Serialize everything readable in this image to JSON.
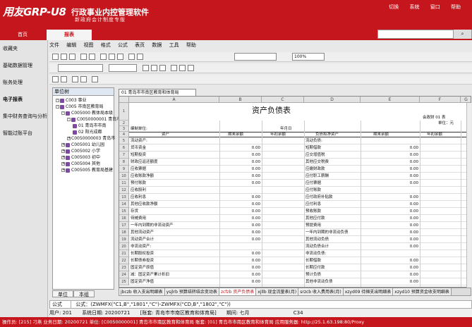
{
  "app": {
    "logo": "用友GRP-U8",
    "product_name": "行政事业内控管理软件",
    "product_sub": "新政府会计制度专版",
    "top_menu": [
      "切换",
      "系统",
      "窗口",
      "帮助"
    ]
  },
  "modules": {
    "home": "首页",
    "report": "报表"
  },
  "left_nav": [
    "收藏夹",
    "基础数据管理",
    "账务处理",
    "电子报表",
    "集中财务查询与分析",
    "智能过账平台"
  ],
  "menubar": [
    "文件",
    "编辑",
    "视图",
    "格式",
    "公式",
    "表页",
    "数据",
    "工具",
    "帮助"
  ],
  "toolbar": {
    "zoom": "100%"
  },
  "tree": {
    "header": "单位树",
    "nodes": [
      "C003 事业",
      "C005 市南区教育局",
      "C005000 教体局本级",
      "C0050000001 青岛市市",
      "01 青岛市市南",
      "02 阳光成都",
      "C0050000003 青岛市",
      "C005001 幼儿园",
      "C005002 小学",
      "C005003 初中",
      "C005004 其他",
      "C005005 教育局基建"
    ],
    "tabs": [
      "单位",
      "本组"
    ]
  },
  "doc_tab": "01 青岛市市南区教育和体育局",
  "sheet": {
    "columns": [
      "A",
      "B",
      "C",
      "D",
      "E",
      "F",
      "G"
    ],
    "title": "资产负债表",
    "form_no": "会政财 01 表",
    "unit_label": "单位：元",
    "compiler": "编制单位:",
    "period": "年月日",
    "headers": [
      "资产",
      "期末余额",
      "年初余额",
      "负债和净资产",
      "期末余额",
      "年初余额"
    ],
    "rows": [
      {
        "n": "5",
        "a": "流动资产:",
        "d": "流动负债:",
        "b": "",
        "c": "",
        "e": "",
        "f": ""
      },
      {
        "n": "6",
        "a": "货币资金",
        "b": "0.00",
        "c": "",
        "d": "短期借款",
        "e": "0.00",
        "f": ""
      },
      {
        "n": "7",
        "a": "短期投资",
        "b": "0.00",
        "c": "",
        "d": "应交增值税",
        "e": "0.00",
        "f": ""
      },
      {
        "n": "8",
        "a": "财政应返还额度",
        "b": "0.00",
        "c": "",
        "d": "其他应交税费",
        "e": "0.00",
        "f": ""
      },
      {
        "n": "9",
        "a": "应收票据",
        "b": "0.00",
        "c": "",
        "d": "应缴财政款",
        "e": "0.00",
        "f": ""
      },
      {
        "n": "10",
        "a": "应收账款净额",
        "b": "0.00",
        "c": "",
        "d": "应付职工薪酬",
        "e": "0.00",
        "f": ""
      },
      {
        "n": "11",
        "a": "预付账款",
        "b": "0.00",
        "c": "",
        "d": "应付票据",
        "e": "0.00",
        "f": ""
      },
      {
        "n": "12",
        "a": "应收股利",
        "b": "",
        "c": "",
        "d": "应付账款",
        "e": "",
        "f": ""
      },
      {
        "n": "13",
        "a": "应收利息",
        "b": "0.00",
        "c": "",
        "d": "应付政府补贴款",
        "e": "0.00",
        "f": ""
      },
      {
        "n": "14",
        "a": "其他应收款净额",
        "b": "0.00",
        "c": "",
        "d": "应付利息",
        "e": "0.00",
        "f": ""
      },
      {
        "n": "15",
        "a": "存货",
        "b": "0.00",
        "c": "",
        "d": "预收账款",
        "e": "0.00",
        "f": ""
      },
      {
        "n": "16",
        "a": "待摊费用",
        "b": "0.00",
        "c": "",
        "d": "其他应付款",
        "e": "0.00",
        "f": ""
      },
      {
        "n": "17",
        "a": "一年内到期的非流动资产",
        "b": "0.00",
        "c": "",
        "d": "预提费用",
        "e": "0.00",
        "f": ""
      },
      {
        "n": "18",
        "a": "其他流动资产",
        "b": "0.00",
        "c": "",
        "d": "一年内到期的非流动负债",
        "e": "0.00",
        "f": ""
      },
      {
        "n": "19",
        "a": "流动资产合计",
        "b": "0.00",
        "c": "",
        "d": "其他流动负债",
        "e": "0.00",
        "f": ""
      },
      {
        "n": "20",
        "a": "非流动资产:",
        "b": "",
        "c": "",
        "d": "流动负债合计",
        "e": "0.00",
        "f": ""
      },
      {
        "n": "21",
        "a": "长期股权投资",
        "b": "0.00",
        "c": "",
        "d": "非流动负债:",
        "e": "",
        "f": ""
      },
      {
        "n": "22",
        "a": "长期债券投资",
        "b": "0.00",
        "c": "",
        "d": "长期借款",
        "e": "0.00",
        "f": ""
      },
      {
        "n": "23",
        "a": "固定资产原值",
        "b": "0.00",
        "c": "",
        "d": "长期应付款",
        "e": "0.00",
        "f": ""
      },
      {
        "n": "24",
        "a": "减：固定资产累计折旧",
        "b": "0.00",
        "c": "",
        "d": "预计负债",
        "e": "0.00",
        "f": ""
      },
      {
        "n": "25",
        "a": "固定资产净值",
        "b": "0.00",
        "c": "",
        "d": "其他非流动负债",
        "e": "0.00",
        "f": ""
      }
    ]
  },
  "sheet_tabs": [
    "jbczb 收入支出明细表",
    "ysjlrb 预算结转结余变动表",
    "zcfzb 资产负债表",
    "xjllb 现金流量表(月)",
    "srzcb 收入费用表(月)",
    "xzyd09 待摊支出明细表",
    "xzyd10 预算资金收支明细表"
  ],
  "formula": {
    "name": "公式",
    "text": "公式：(ZWMFX(\"C1,B\",\"1801\",\"C\")-ZWMFX(\"CD,B\",\"1802\",\"C\"))"
  },
  "status_line": {
    "user": "用户: 201",
    "date": "系统日期: 20200721",
    "unit": "[账套: 青岛市市南区教育和体育局]",
    "period": "期间: 七月",
    "cell": "C34"
  },
  "bottom": "操作员: [215] 刁燕    业务日期: 20200721    单位: [C0050000001] 青岛市市南区教育和体育局    账套: [01] 青岛市市南区教育和体育局    应用服务器: http://25.1.63.198:80/Proxy"
}
